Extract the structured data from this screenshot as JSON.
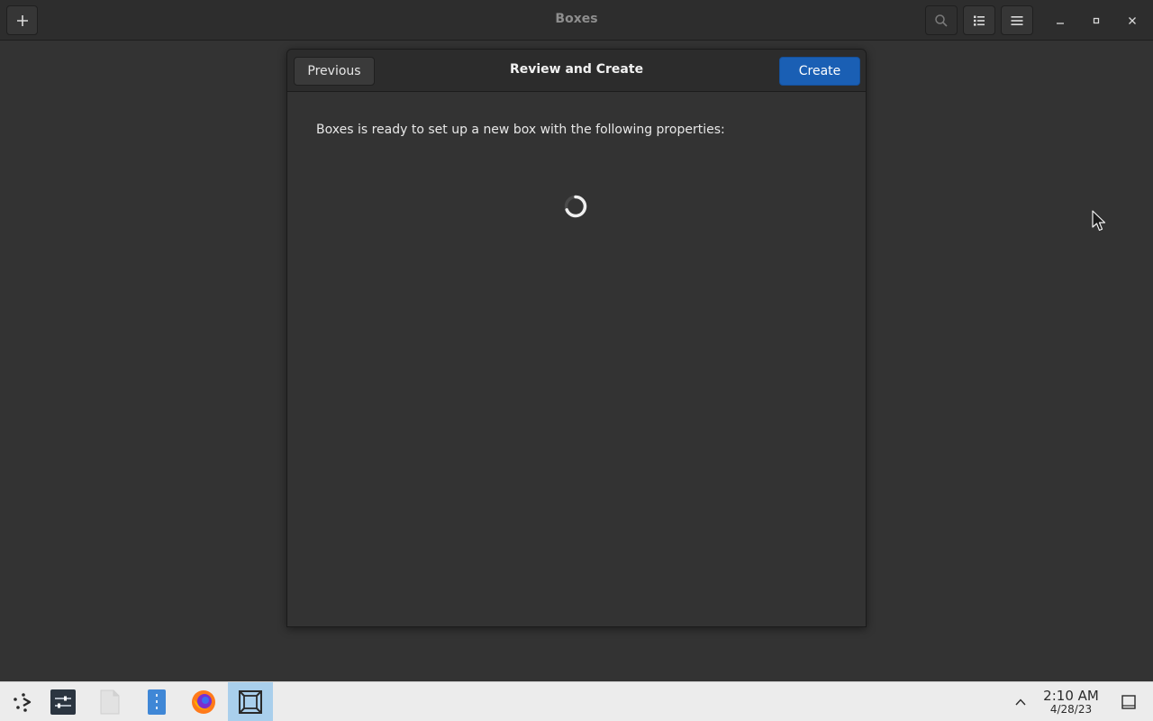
{
  "window": {
    "title": "Boxes"
  },
  "header": {
    "icons": {
      "add": "plus-icon",
      "search": "search-icon",
      "view": "list-view-icon",
      "menu": "hamburger-menu-icon",
      "minimize": "minimize-icon",
      "maximize": "maximize-icon",
      "close": "close-icon"
    }
  },
  "dialog": {
    "title": "Review and Create",
    "previous_label": "Previous",
    "create_label": "Create",
    "message": "Boxes is ready to set up a new box with the following properties:",
    "loading": true
  },
  "taskbar": {
    "apps": [
      {
        "name": "launcher",
        "icon": "app-launcher-icon"
      },
      {
        "name": "settings",
        "icon": "settings-panel-icon"
      },
      {
        "name": "files",
        "icon": "document-icon"
      },
      {
        "name": "notes",
        "icon": "notes-icon"
      },
      {
        "name": "firefox",
        "icon": "firefox-icon"
      },
      {
        "name": "boxes",
        "icon": "boxes-icon",
        "active": true
      }
    ],
    "clock": {
      "time": "2:10 AM",
      "date": "4/28/23"
    }
  },
  "colors": {
    "accent": "#1a5fb4",
    "active_task": "#a9cfec"
  }
}
